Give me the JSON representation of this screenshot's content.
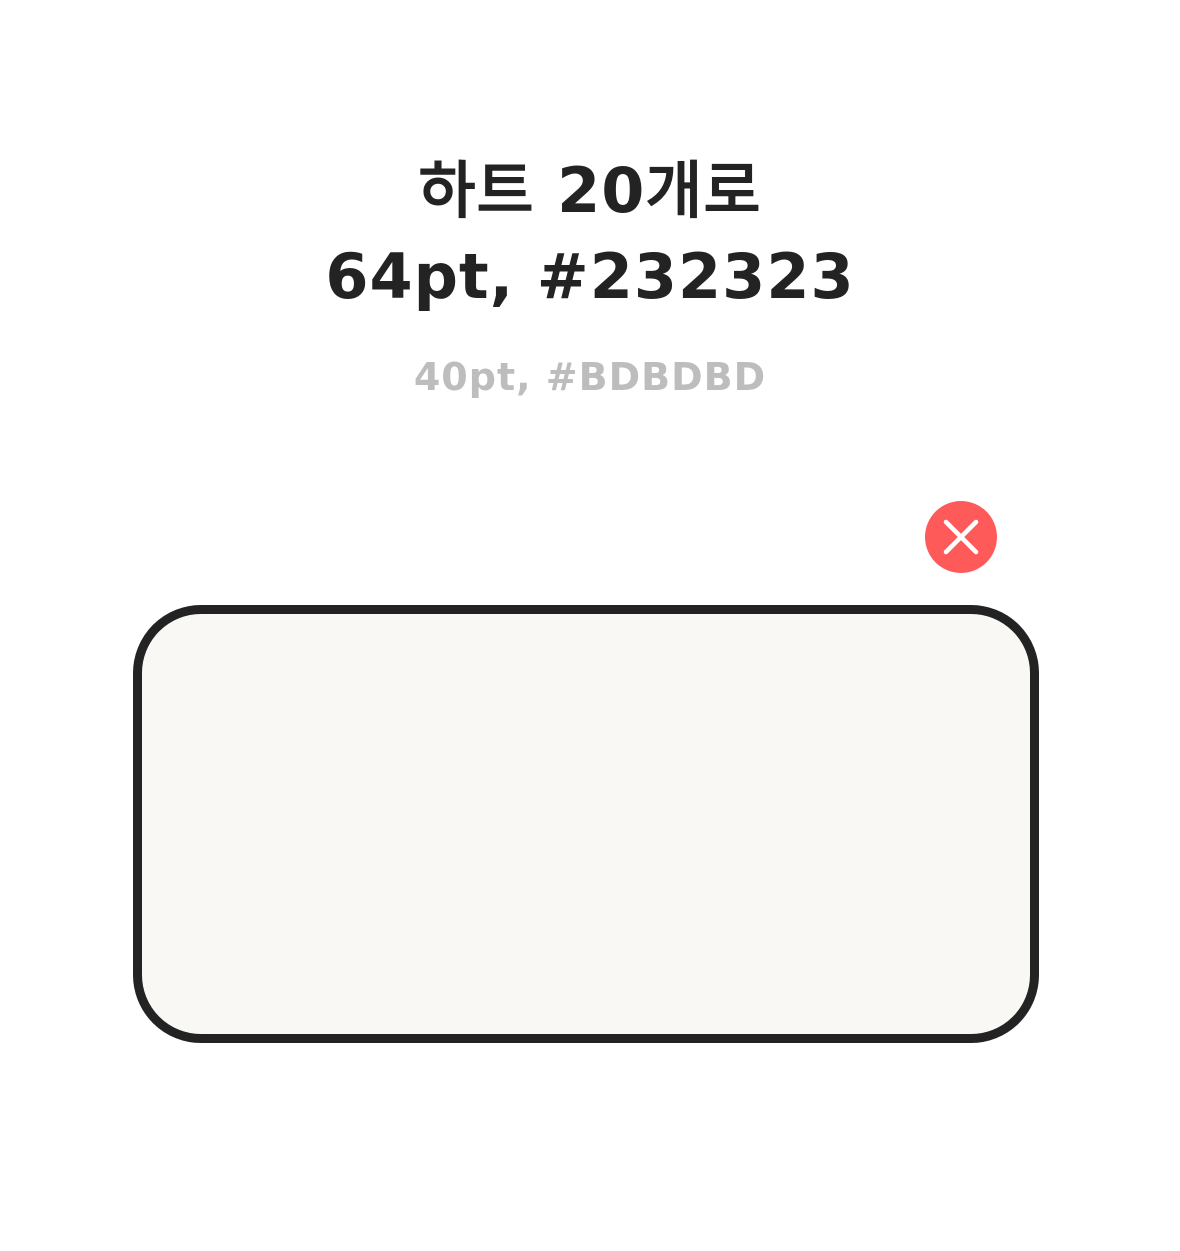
{
  "heading": {
    "line1": "하트 20개로",
    "line2": "64pt, #232323"
  },
  "subheading": "40pt, #BDBDBD",
  "close_button": {
    "icon": "close-icon",
    "color": "#FF5A5A"
  },
  "text_box": {
    "value": "",
    "background": "#F9F8F4",
    "border_color": "#232323"
  },
  "colors": {
    "heading": "#232323",
    "subheading": "#BDBDBD"
  }
}
